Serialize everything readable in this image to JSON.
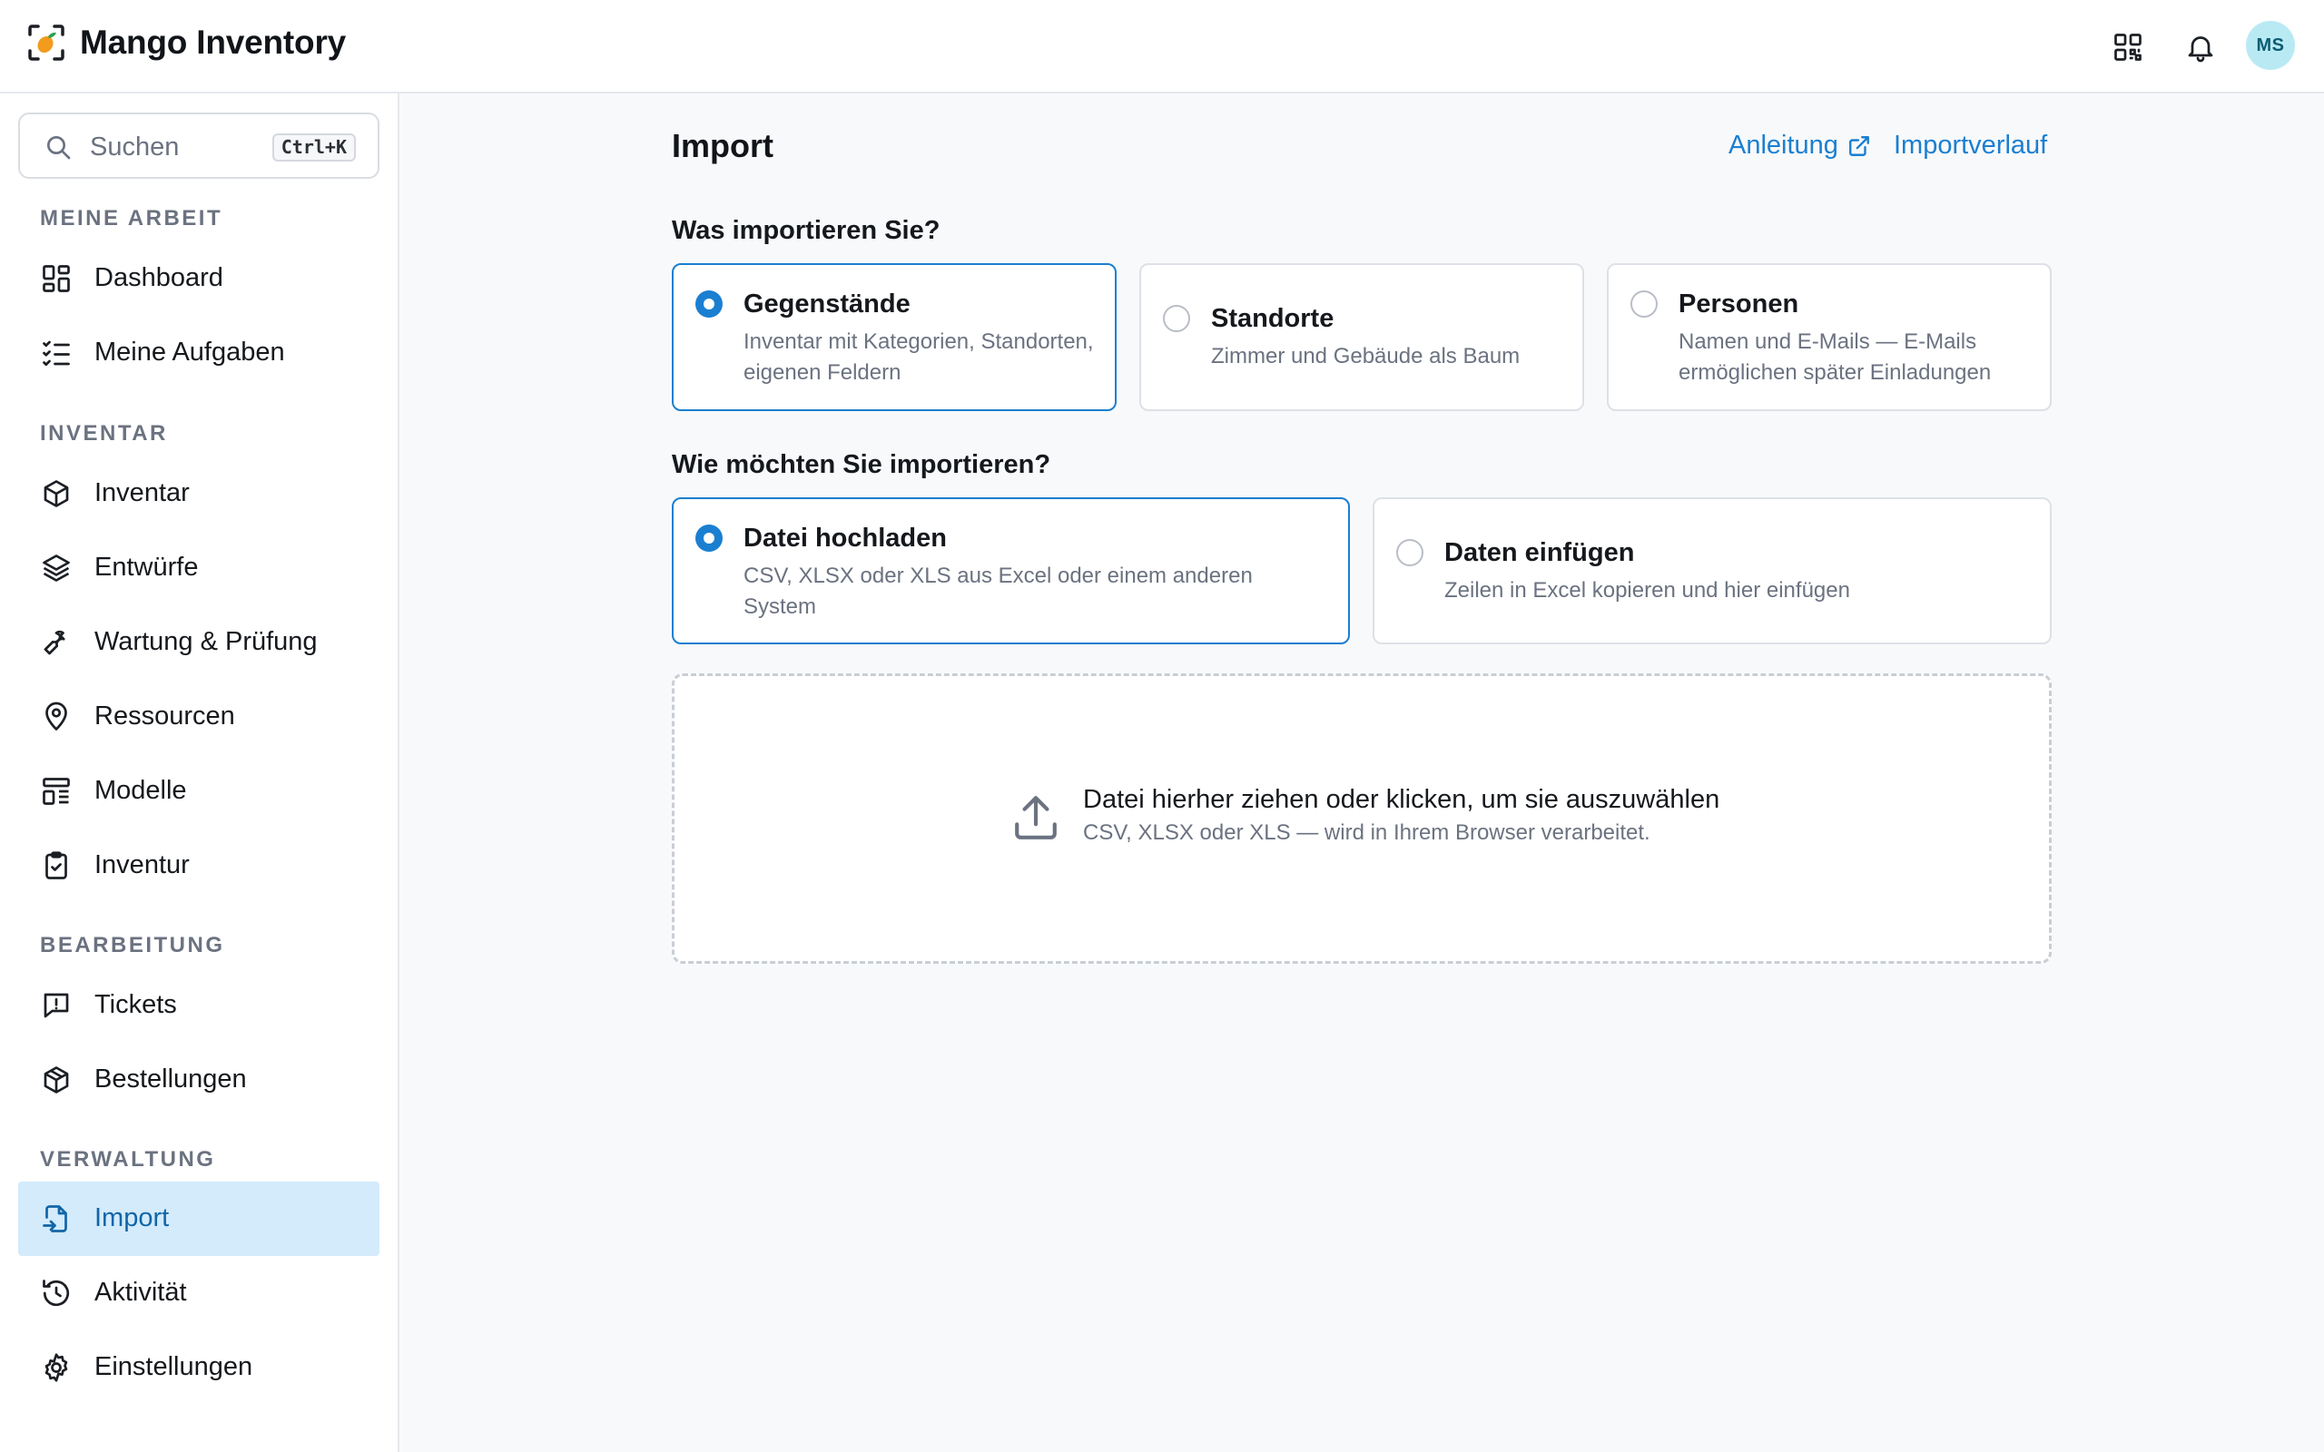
{
  "app": {
    "title": "Mango Inventory",
    "avatar_initials": "MS",
    "brand_color": "#f29b1d",
    "accent_color": "#1a7fd1"
  },
  "header": {
    "icons": [
      "qr-code-icon",
      "bell-icon"
    ]
  },
  "search": {
    "placeholder": "Suchen",
    "shortcut": "Ctrl+K"
  },
  "sidebar": {
    "sections": [
      {
        "label": "MEINE ARBEIT",
        "items": [
          {
            "label": "Dashboard",
            "icon": "dashboard-icon"
          },
          {
            "label": "Meine Aufgaben",
            "icon": "checklist-icon"
          }
        ]
      },
      {
        "label": "INVENTAR",
        "items": [
          {
            "label": "Inventar",
            "icon": "box-icon"
          },
          {
            "label": "Entwürfe",
            "icon": "layers-icon"
          },
          {
            "label": "Wartung & Prüfung",
            "icon": "wrench-icon"
          },
          {
            "label": "Ressourcen",
            "icon": "map-pin-icon"
          },
          {
            "label": "Modelle",
            "icon": "template-icon"
          },
          {
            "label": "Inventur",
            "icon": "clipboard-check-icon"
          }
        ]
      },
      {
        "label": "BEARBEITUNG",
        "items": [
          {
            "label": "Tickets",
            "icon": "message-alert-icon"
          },
          {
            "label": "Bestellungen",
            "icon": "package-icon"
          }
        ]
      },
      {
        "label": "VERWALTUNG",
        "items": [
          {
            "label": "Import",
            "icon": "file-import-icon",
            "active": true
          },
          {
            "label": "Aktivität",
            "icon": "history-icon"
          },
          {
            "label": "Einstellungen",
            "icon": "gear-icon"
          }
        ]
      }
    ]
  },
  "main": {
    "title": "Import",
    "links": {
      "guide": "Anleitung",
      "history": "Importverlauf"
    },
    "what_question": "Was importieren Sie?",
    "what_options": [
      {
        "title": "Gegenstände",
        "desc": "Inventar mit Kategorien, Standorten, eigenen Feldern",
        "selected": true
      },
      {
        "title": "Standorte",
        "desc": "Zimmer und Gebäude als Baum",
        "selected": false
      },
      {
        "title": "Personen",
        "desc": "Namen und E-Mails — E-Mails ermöglichen später Einladungen",
        "selected": false
      }
    ],
    "how_question": "Wie möchten Sie importieren?",
    "how_options": [
      {
        "title": "Datei hochladen",
        "desc": "CSV, XLSX oder XLS aus Excel oder einem anderen System",
        "selected": true
      },
      {
        "title": "Daten einfügen",
        "desc": "Zeilen in Excel kopieren und hier einfügen",
        "selected": false
      }
    ],
    "dropzone": {
      "title": "Datei hierher ziehen oder klicken, um sie auszuwählen",
      "subtitle": "CSV, XLSX oder XLS — wird in Ihrem Browser verarbeitet."
    }
  }
}
